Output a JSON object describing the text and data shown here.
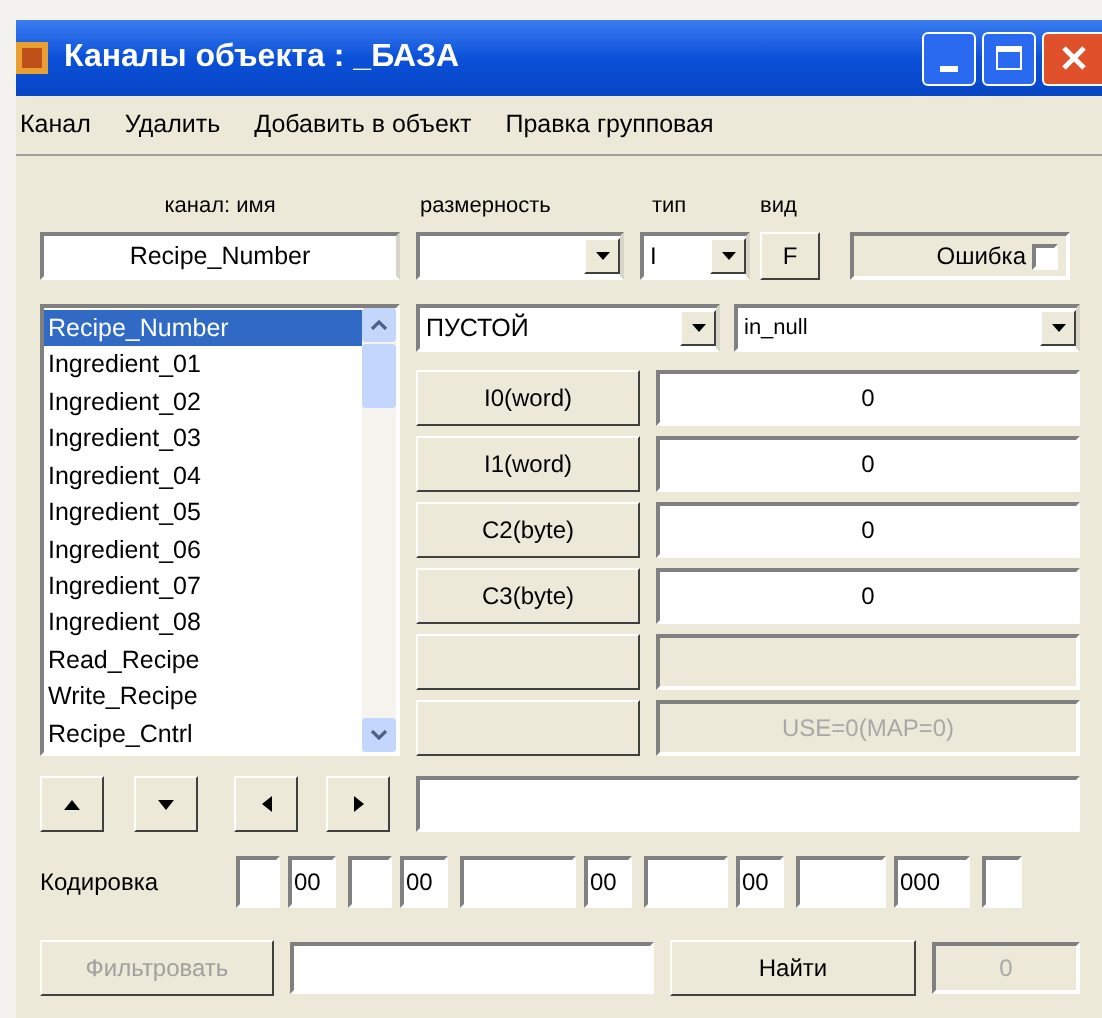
{
  "window": {
    "title": "Каналы объекта : _БАЗА"
  },
  "menu": [
    {
      "label": "Канал"
    },
    {
      "label": "Удалить"
    },
    {
      "label": "Добавить в объект"
    },
    {
      "label": "Правка групповая"
    }
  ],
  "headers": {
    "name": "канал: имя",
    "dimension": "размерность",
    "type": "тип",
    "view": "вид"
  },
  "name_field": {
    "value": "Recipe_Number"
  },
  "type_combo": {
    "value": "I"
  },
  "view_button": {
    "label": "F"
  },
  "error_checkbox": {
    "label": "Ошибка",
    "checked": false
  },
  "channels": [
    {
      "label": "Recipe_Number",
      "selected": true
    },
    {
      "label": "Ingredient_01",
      "selected": false
    },
    {
      "label": "Ingredient_02",
      "selected": false
    },
    {
      "label": "Ingredient_03",
      "selected": false
    },
    {
      "label": "Ingredient_04",
      "selected": false
    },
    {
      "label": "Ingredient_05",
      "selected": false
    },
    {
      "label": "Ingredient_06",
      "selected": false
    },
    {
      "label": "Ingredient_07",
      "selected": false
    },
    {
      "label": "Ingredient_08",
      "selected": false
    },
    {
      "label": "Read_Recipe",
      "selected": false
    },
    {
      "label": "Write_Recipe",
      "selected": false
    },
    {
      "label": "Recipe_Cntrl",
      "selected": false
    }
  ],
  "source_combo": {
    "value": "ПУСТОЙ"
  },
  "signal_combo": {
    "value": "in_null"
  },
  "registers": [
    {
      "label": "I0(word)",
      "value": "0",
      "disabled": false
    },
    {
      "label": "I1(word)",
      "value": "0",
      "disabled": false
    },
    {
      "label": "C2(byte)",
      "value": "0",
      "disabled": false
    },
    {
      "label": "C3(byte)",
      "value": "0",
      "disabled": false
    },
    {
      "disabled": true
    },
    {
      "value": "USE=0(MAP=0)",
      "disabled": true
    }
  ],
  "encoding": {
    "label": "Кодировка",
    "fields": [
      {
        "kind": "empty"
      },
      {
        "kind": "value",
        "value": "00"
      },
      {
        "kind": "empty"
      },
      {
        "kind": "value",
        "value": "00"
      },
      {
        "kind": "empty"
      },
      {
        "kind": "value",
        "value": "00"
      },
      {
        "kind": "empty"
      },
      {
        "kind": "value",
        "value": "00"
      },
      {
        "kind": "empty"
      },
      {
        "kind": "value",
        "value": "000"
      },
      {
        "kind": "empty"
      }
    ]
  },
  "filter_button": {
    "label": "Фильтровать",
    "disabled": true
  },
  "find_button": {
    "label": "Найти"
  },
  "count_field": {
    "value": "0",
    "disabled": true
  }
}
